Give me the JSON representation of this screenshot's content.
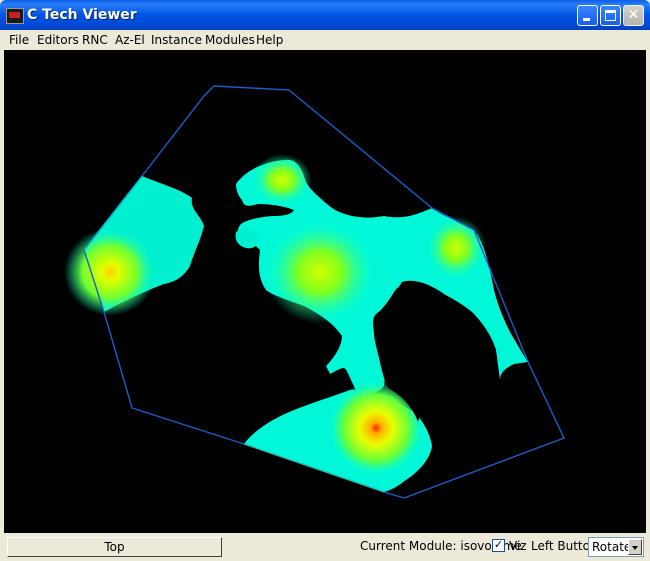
{
  "window": {
    "title": "C Tech Viewer"
  },
  "menu": [
    "File",
    "Editors",
    "RNC",
    "Az-El",
    "Instance",
    "Modules",
    "Help"
  ],
  "statusbar": {
    "view_button": "Top",
    "current_module": "Current Module: isovolume",
    "viz_checked": true,
    "viz_label": "Viz",
    "left_button_label": "Left Button",
    "left_button_mode": "Rotate"
  },
  "colors": {
    "background": "#000000",
    "boundary": "#1e5cc8",
    "isovolume_low": "#00ffe0",
    "isovolume_mid": "#ffff00",
    "isovolume_high": "#ff0000"
  }
}
